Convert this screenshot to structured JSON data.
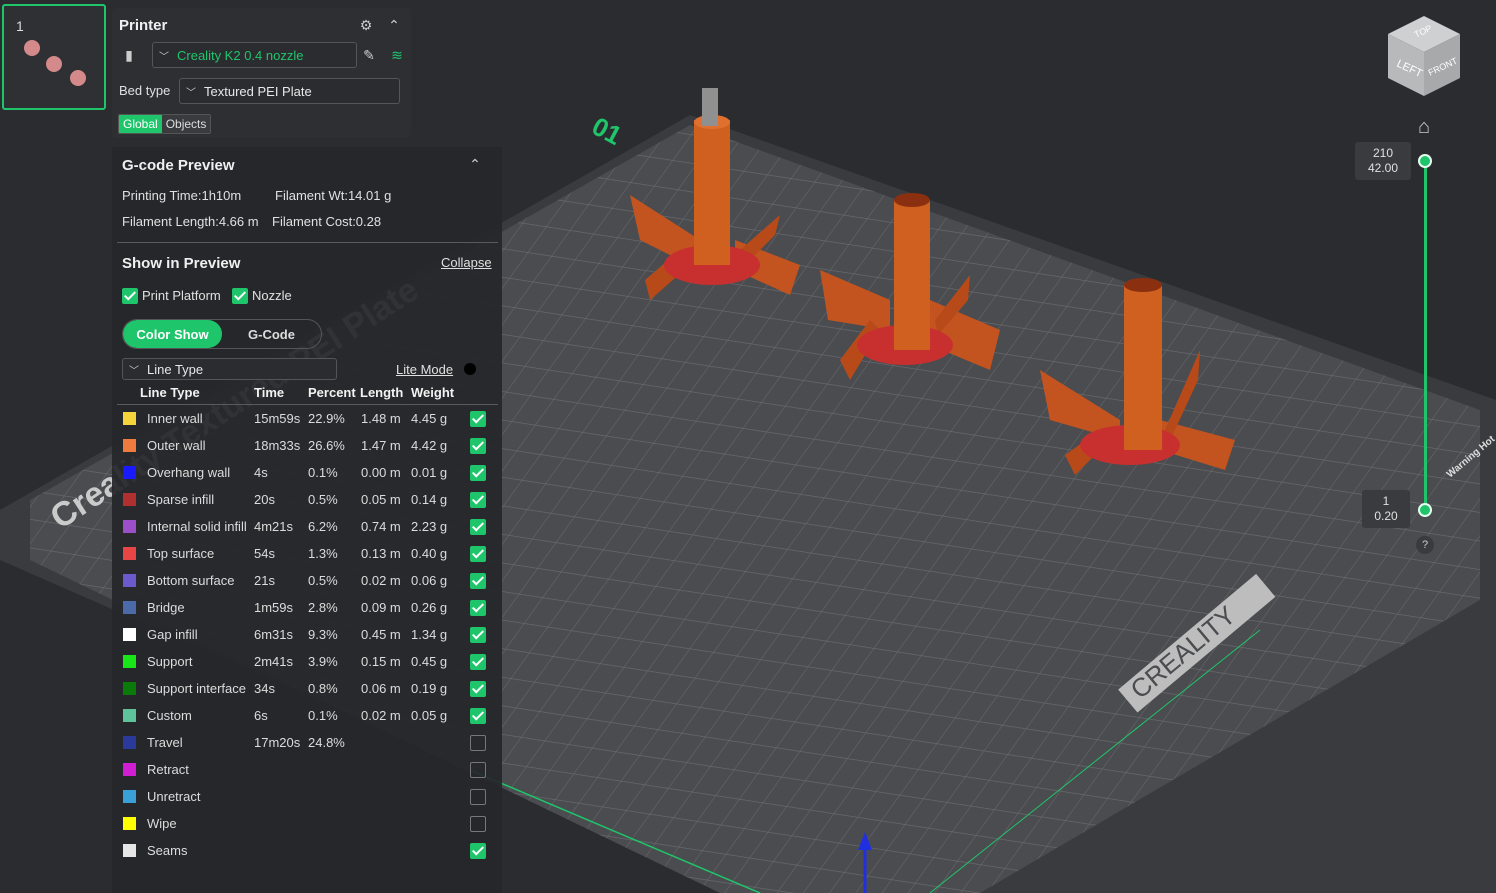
{
  "plate": {
    "number": "1"
  },
  "printer": {
    "title": "Printer",
    "preset": "Creality K2 0.4 nozzle",
    "bed_type_label": "Bed type",
    "bed_type": "Textured PEI Plate",
    "tab_global": "Global",
    "tab_objects": "Objects"
  },
  "gcode": {
    "title": "G-code Preview",
    "printing_time": "Printing Time:1h10m",
    "filament_wt": "Filament Wt:14.01 g",
    "filament_length": "Filament Length:4.66 m",
    "filament_cost": "Filament Cost:0.28",
    "show_title": "Show in Preview",
    "collapse": "Collapse",
    "print_platform": "Print Platform",
    "nozzle": "Nozzle",
    "color_show": "Color Show",
    "gcode_tab": "G-Code",
    "line_type_select": "Line Type",
    "lite_mode": "Lite Mode",
    "headers": {
      "line_type": "Line Type",
      "time": "Time",
      "percent": "Percent",
      "length": "Length",
      "weight": "Weight"
    },
    "rows": [
      {
        "name": "Inner wall",
        "time": "15m59s",
        "percent": "22.9%",
        "length": "1.48 m",
        "weight": "4.45 g",
        "color": "#f5d33a",
        "checked": true
      },
      {
        "name": "Outer wall",
        "time": "18m33s",
        "percent": "26.6%",
        "length": "1.47 m",
        "weight": "4.42 g",
        "color": "#f07b3f",
        "checked": true
      },
      {
        "name": "Overhang wall",
        "time": "4s",
        "percent": "0.1%",
        "length": "0.00 m",
        "weight": "0.01 g",
        "color": "#1a1aff",
        "checked": true
      },
      {
        "name": "Sparse infill",
        "time": "20s",
        "percent": "0.5%",
        "length": "0.05 m",
        "weight": "0.14 g",
        "color": "#b03030",
        "checked": true
      },
      {
        "name": "Internal solid infill",
        "time": "4m21s",
        "percent": "6.2%",
        "length": "0.74 m",
        "weight": "2.23 g",
        "color": "#9b4fc9",
        "checked": true
      },
      {
        "name": "Top surface",
        "time": "54s",
        "percent": "1.3%",
        "length": "0.13 m",
        "weight": "0.40 g",
        "color": "#e84545",
        "checked": true
      },
      {
        "name": "Bottom surface",
        "time": "21s",
        "percent": "0.5%",
        "length": "0.02 m",
        "weight": "0.06 g",
        "color": "#6a5acd",
        "checked": true
      },
      {
        "name": "Bridge",
        "time": "1m59s",
        "percent": "2.8%",
        "length": "0.09 m",
        "weight": "0.26 g",
        "color": "#4a6aa8",
        "checked": true
      },
      {
        "name": "Gap infill",
        "time": "6m31s",
        "percent": "9.3%",
        "length": "0.45 m",
        "weight": "1.34 g",
        "color": "#ffffff",
        "checked": true
      },
      {
        "name": "Support",
        "time": "2m41s",
        "percent": "3.9%",
        "length": "0.15 m",
        "weight": "0.45 g",
        "color": "#19e619",
        "checked": true
      },
      {
        "name": "Support interface",
        "time": "34s",
        "percent": "0.8%",
        "length": "0.06 m",
        "weight": "0.19 g",
        "color": "#0a7a0a",
        "checked": true
      },
      {
        "name": "Custom",
        "time": "6s",
        "percent": "0.1%",
        "length": "0.02 m",
        "weight": "0.05 g",
        "color": "#5ec39a",
        "checked": true
      },
      {
        "name": "Travel",
        "time": "17m20s",
        "percent": "24.8%",
        "length": "",
        "weight": "",
        "color": "#2a3a9a",
        "checked": false
      },
      {
        "name": "Retract",
        "time": "",
        "percent": "",
        "length": "",
        "weight": "",
        "color": "#d21ed2",
        "checked": false
      },
      {
        "name": "Unretract",
        "time": "",
        "percent": "",
        "length": "",
        "weight": "",
        "color": "#3aa0d8",
        "checked": false
      },
      {
        "name": "Wipe",
        "time": "",
        "percent": "",
        "length": "",
        "weight": "",
        "color": "#ffff00",
        "checked": false
      },
      {
        "name": "Seams",
        "time": "",
        "percent": "",
        "length": "",
        "weight": "",
        "color": "#e6e6e6",
        "checked": true
      }
    ]
  },
  "scene": {
    "plate_label": "01",
    "bed_text": "Creality Textured PEI Plate",
    "brand": "CREALITY",
    "warning": "Warning Hot"
  },
  "view_cube": {
    "top": "TOP",
    "left": "LEFT",
    "front": "FRONT"
  },
  "layer_slider": {
    "top_layer": "210",
    "top_height": "42.00",
    "bottom_layer": "1",
    "bottom_height": "0.20",
    "help": "?"
  }
}
